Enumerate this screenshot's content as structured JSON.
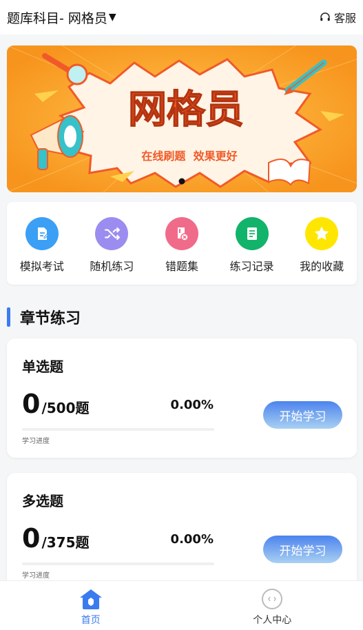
{
  "header": {
    "subject_label": "题库科目- 网格员",
    "caret_icon": "caret-down-icon",
    "service_icon": "headset-icon",
    "service_label": "客服"
  },
  "banner": {
    "title": "网格员",
    "subtitle": "在线刷题  效果更好",
    "colors": {
      "bg": "#f7941d",
      "title_fill": "#f05a28",
      "cloud": "#fff4e6"
    },
    "page_indicator_active": 1,
    "page_indicator_total": 1
  },
  "quick_actions": [
    {
      "label": "模拟考试",
      "icon": "exam-doc-icon",
      "color": "#3b9ff5"
    },
    {
      "label": "随机练习",
      "icon": "shuffle-icon",
      "color": "#9b8cf0"
    },
    {
      "label": "错题集",
      "icon": "wrong-book-icon",
      "color": "#f06b8a"
    },
    {
      "label": "练习记录",
      "icon": "record-icon",
      "color": "#12b36b"
    },
    {
      "label": "我的收藏",
      "icon": "star-icon",
      "color": "#ffe600"
    }
  ],
  "section": {
    "title": "章节练习",
    "accent": "#3a7bf0"
  },
  "cards": [
    {
      "title": "单选题",
      "done": "0",
      "total": "/500题",
      "percent": "0.00%",
      "progress": 0,
      "progress_label": "学习进度",
      "button": "开始学习"
    },
    {
      "title": "多选题",
      "done": "0",
      "total": "/375题",
      "percent": "0.00%",
      "progress": 0,
      "progress_label": "学习进度",
      "button": "开始学习"
    }
  ],
  "tabbar": [
    {
      "label": "首页",
      "icon": "home-icon",
      "active": true,
      "color": "#3a7bf0"
    },
    {
      "label": "个人中心",
      "icon": "profile-icon",
      "active": false,
      "color": "#333333"
    }
  ]
}
